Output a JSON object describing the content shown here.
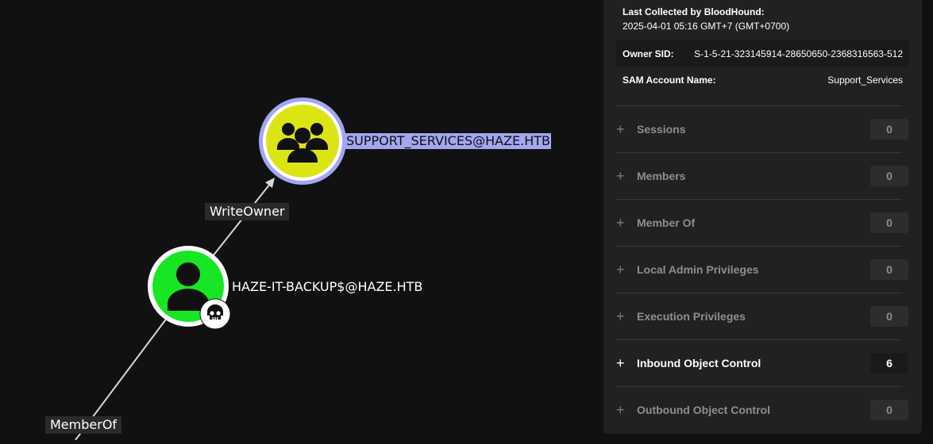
{
  "graph": {
    "nodes": [
      {
        "label": "SUPPORT_SERVICES@HAZE.HTB",
        "type": "group",
        "selected": true,
        "color": "#dbe514",
        "ring": "#a2a7f2"
      },
      {
        "label": "HAZE-IT-BACKUP$@HAZE.HTB",
        "type": "user",
        "selected": false,
        "color": "#17e625",
        "badge": "skull-icon"
      }
    ],
    "edges": [
      {
        "label": "WriteOwner"
      },
      {
        "label": "MemberOf"
      }
    ]
  },
  "panel": {
    "last_collected_title": "Last Collected by BloodHound:",
    "last_collected_value": "2025-04-01 05:16 GMT+7 (GMT+0700)",
    "properties": [
      {
        "key": "Owner SID:",
        "value": "S-1-5-21-323145914-28650650-2368316563-512"
      },
      {
        "key": "SAM Account Name:",
        "value": "Support_Services"
      }
    ],
    "sections": [
      {
        "label": "Sessions",
        "count": "0",
        "active": false
      },
      {
        "label": "Members",
        "count": "0",
        "active": false
      },
      {
        "label": "Member Of",
        "count": "0",
        "active": false
      },
      {
        "label": "Local Admin Privileges",
        "count": "0",
        "active": false
      },
      {
        "label": "Execution Privileges",
        "count": "0",
        "active": false
      },
      {
        "label": "Inbound Object Control",
        "count": "6",
        "active": true
      },
      {
        "label": "Outbound Object Control",
        "count": "0",
        "active": false
      }
    ]
  }
}
